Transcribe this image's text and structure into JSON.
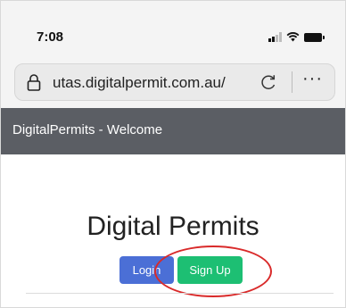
{
  "status_bar": {
    "time": "7:08"
  },
  "browser": {
    "url": "utas.digitalpermit.com.au/",
    "more_label": "···"
  },
  "navbar": {
    "brand": "DigitalPermits - Welcome"
  },
  "main": {
    "title": "Digital Permits",
    "login_label": "Login",
    "signup_label": "Sign Up"
  },
  "colors": {
    "navbar_bg": "#5b5e64",
    "login_button": "#4b6fd6",
    "signup_button": "#1dbf73",
    "highlight": "#d92a2a"
  },
  "icons": [
    "signal-icon",
    "wifi-icon",
    "battery-icon",
    "lock-icon",
    "reload-icon",
    "more-icon"
  ]
}
